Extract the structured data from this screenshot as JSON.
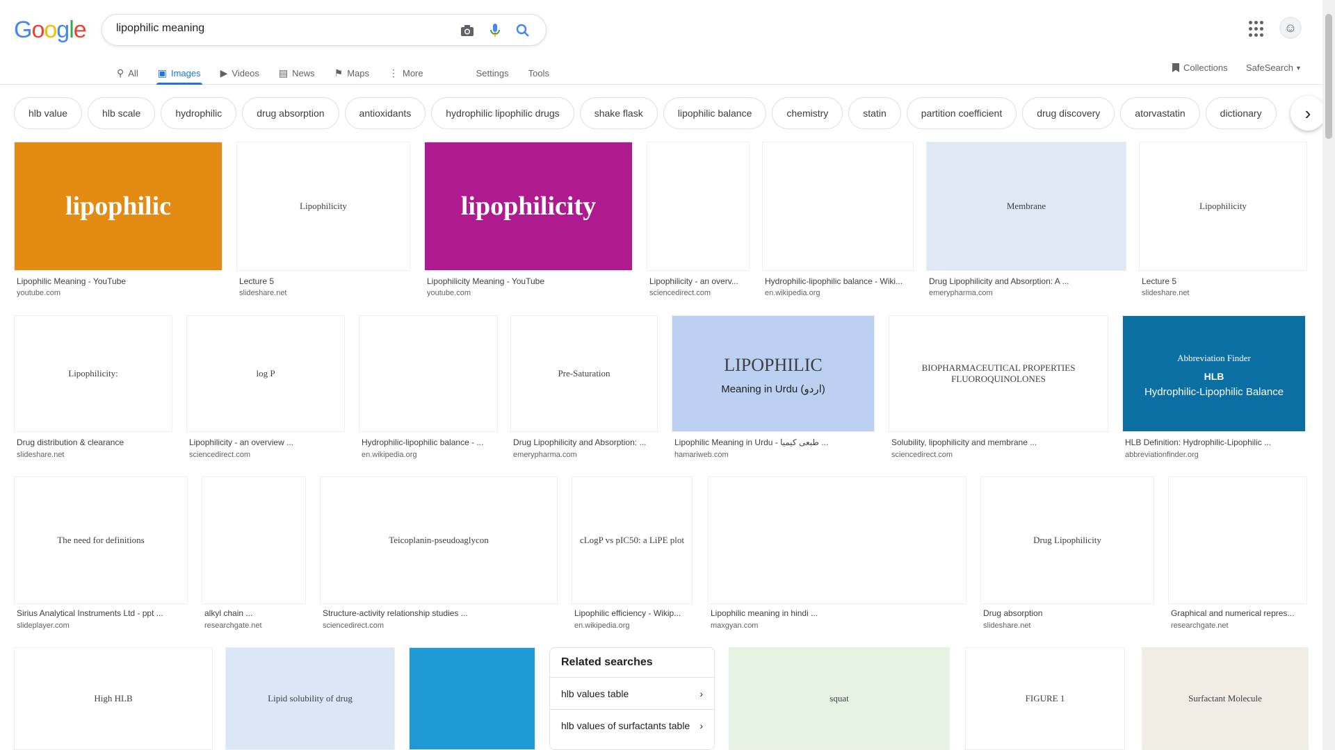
{
  "logo": {
    "letters": [
      "G",
      "o",
      "o",
      "g",
      "l",
      "e"
    ],
    "colors": [
      "#4285f4",
      "#ea4335",
      "#fbbc05",
      "#4285f4",
      "#34a853",
      "#ea4335"
    ]
  },
  "search": {
    "query": "lipophilic meaning"
  },
  "tabs": [
    {
      "label": "All",
      "icon": "search-icon",
      "active": false
    },
    {
      "label": "Images",
      "icon": "image-icon",
      "active": true
    },
    {
      "label": "Videos",
      "icon": "video-icon",
      "active": false
    },
    {
      "label": "News",
      "icon": "news-icon",
      "active": false
    },
    {
      "label": "Maps",
      "icon": "map-icon",
      "active": false
    },
    {
      "label": "More",
      "icon": "more-icon",
      "active": false
    }
  ],
  "tools": {
    "settings": "Settings",
    "tools": "Tools"
  },
  "header_right": {
    "collections": "Collections",
    "safesearch": "SafeSearch"
  },
  "chips": [
    "hlb value",
    "hlb scale",
    "hydrophilic",
    "drug absorption",
    "antioxidants",
    "hydrophilic lipophilic drugs",
    "shake flask",
    "lipophilic balance",
    "chemistry",
    "statin",
    "partition coefficient",
    "drug discovery",
    "atorvastatin",
    "dictionary"
  ],
  "results": {
    "row1": [
      {
        "title": "Lipophilic Meaning - YouTube",
        "site": "youtube.com",
        "label": "lipophilic"
      },
      {
        "title": "Lecture 5",
        "site": "slideshare.net",
        "label": "Lipophilicity"
      },
      {
        "title": "Lipophilicity Meaning - YouTube",
        "site": "youtube.com",
        "label": "lipophilicity"
      },
      {
        "title": "Lipophilicity - an overv...",
        "site": "sciencedirect.com",
        "label": ""
      },
      {
        "title": "Hydrophilic-lipophilic balance - Wiki...",
        "site": "en.wikipedia.org",
        "label": ""
      },
      {
        "title": "Drug Lipophilicity and Absorption: A ...",
        "site": "emerypharma.com",
        "label": "Membrane"
      },
      {
        "title": "Lecture 5",
        "site": "slideshare.net",
        "label": "Lipophilicity"
      }
    ],
    "row2": [
      {
        "title": "Drug distribution & clearance",
        "site": "slideshare.net",
        "label": "Lipophilicity:"
      },
      {
        "title": "Lipophilicity - an overview ...",
        "site": "sciencedirect.com",
        "label": "log P"
      },
      {
        "title": "Hydrophilic-lipophilic balance - ...",
        "site": "en.wikipedia.org",
        "label": ""
      },
      {
        "title": "Drug Lipophilicity and Absorption: ...",
        "site": "emerypharma.com",
        "label": "Pre-Saturation"
      },
      {
        "title": "Lipophilic Meaning in Urdu - طبعی کیمیا ...",
        "site": "hamariweb.com",
        "label": "LIPOPHILIC",
        "sub": "Meaning in Urdu (اردو)"
      },
      {
        "title": "Solubility, lipophilicity and membrane ...",
        "site": "sciencedirect.com",
        "label": "BIOPHARMACEUTICAL PROPERTIES FLUOROQUINOLONES"
      },
      {
        "title": "HLB Definition: Hydrophilic-Lipophilic ...",
        "site": "abbreviationfinder.org",
        "label": "Abbreviation Finder",
        "sub": "Hydrophilic-Lipophilic Balance",
        "hlb": "HLB"
      }
    ],
    "row3": [
      {
        "title": "Sirius Analytical Instruments Ltd - ppt ...",
        "site": "slideplayer.com",
        "label": "The need for definitions"
      },
      {
        "title": "alkyl chain ...",
        "site": "researchgate.net",
        "label": ""
      },
      {
        "title": "Structure-activity relationship studies ...",
        "site": "sciencedirect.com",
        "label": "Teicoplanin-pseudoaglycon"
      },
      {
        "title": "Lipophilic efficiency - Wikip...",
        "site": "en.wikipedia.org",
        "label": "cLogP vs pIC50: a LiPE plot"
      },
      {
        "title": "Lipophilic meaning in hindi ...",
        "site": "maxgyan.com",
        "label": ""
      },
      {
        "title": "Drug absorption",
        "site": "slideshare.net",
        "label": "Drug Lipophilicity"
      },
      {
        "title": "Graphical and numerical repres...",
        "site": "researchgate.net",
        "label": ""
      }
    ],
    "row4": [
      {
        "label": "High HLB"
      },
      {
        "label": "Lipid solubility of drug"
      },
      {
        "label": ""
      },
      {
        "label": "squat"
      },
      {
        "label": "FIGURE 1"
      },
      {
        "label": "Surfactant Molecule"
      }
    ]
  },
  "related": {
    "heading": "Related searches",
    "items": [
      "hlb values table",
      "hlb values of surfactants table"
    ]
  }
}
